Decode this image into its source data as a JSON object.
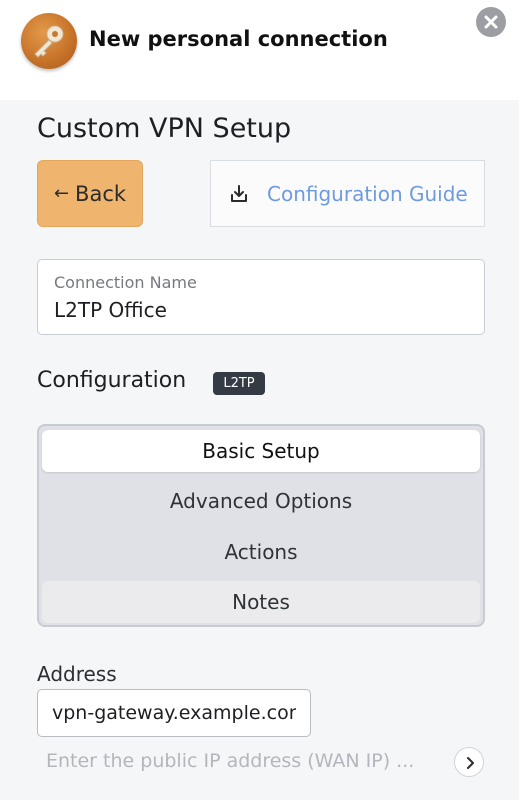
{
  "header": {
    "title": "New personal connection",
    "app_icon": "key-icon",
    "close_icon": "close-icon"
  },
  "page": {
    "title": "Custom VPN Setup",
    "back_label": "Back",
    "back_arrow": "←",
    "guide_label": "Configuration Guide",
    "guide_icon": "download-icon"
  },
  "connection_name": {
    "label": "Connection Name",
    "value": "L2TP Office"
  },
  "configuration": {
    "title": "Configuration",
    "badge": "L2TP",
    "tabs": [
      {
        "label": "Basic Setup",
        "selected": true
      },
      {
        "label": "Advanced Options",
        "selected": false
      },
      {
        "label": "Actions",
        "selected": false
      },
      {
        "label": "Notes",
        "selected": false
      }
    ]
  },
  "address": {
    "label": "Address",
    "value": "vpn-gateway.example.com",
    "hint": "Enter the public IP address (WAN IP) ...",
    "hint_icon": "chevron-right-icon"
  },
  "colors": {
    "accent": "#efb56e",
    "link": "#6e9be0",
    "badge": "#353b45"
  }
}
